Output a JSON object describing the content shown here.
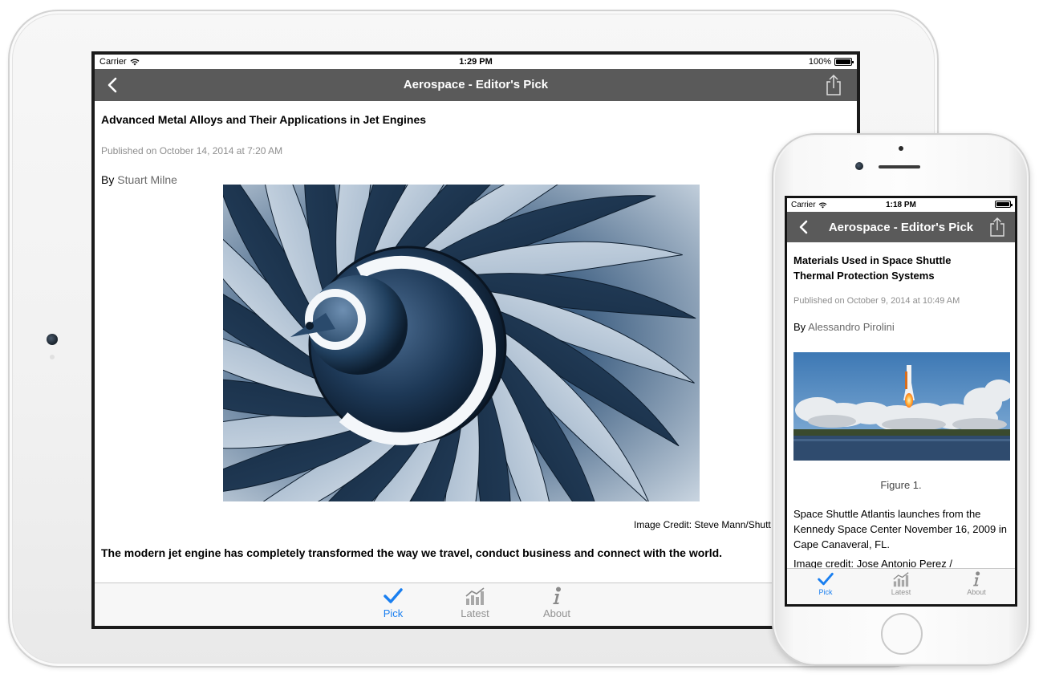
{
  "ipad": {
    "status": {
      "carrier": "Carrier",
      "time": "1:29 PM",
      "battery": "100%"
    },
    "nav": {
      "title": "Aerospace - Editor's Pick"
    },
    "article": {
      "title": "Advanced Metal Alloys and Their Applications in Jet Engines",
      "published": "Published on October 14, 2014 at 7:20 AM",
      "by": "By",
      "author": "Stuart Milne",
      "image_credit": "Image Credit: Steve Mann/Shutt",
      "lead": "The modern jet engine has completely transformed the way we travel, conduct business and connect with the world."
    },
    "tabs": [
      {
        "label": "Pick",
        "icon": "checkmark-icon",
        "active": true
      },
      {
        "label": "Latest",
        "icon": "chart-icon",
        "active": false
      },
      {
        "label": "About",
        "icon": "info-icon",
        "active": false
      }
    ]
  },
  "iphone": {
    "status": {
      "carrier": "Carrier",
      "time": "1:18 PM"
    },
    "nav": {
      "title": "Aerospace - Editor's Pick"
    },
    "article": {
      "title": "Materials Used in Space Shuttle Thermal Protection Systems",
      "published": "Published on October 9, 2014 at 10:49 AM",
      "by": "By",
      "author": "Alessandro Pirolini",
      "figure": "Figure 1.",
      "caption": "Space Shuttle Atlantis launches from the Kennedy Space Center November 16, 2009 in Cape Canaveral, FL.",
      "credit": "Image credit: Jose Antonio Perez /"
    },
    "tabs": [
      {
        "label": "Pick",
        "icon": "checkmark-icon",
        "active": true
      },
      {
        "label": "Latest",
        "icon": "chart-icon",
        "active": false
      },
      {
        "label": "About",
        "icon": "info-icon",
        "active": false
      }
    ]
  },
  "colors": {
    "navbar": "#5a5a5a",
    "active_tab": "#1a7ff0",
    "inactive_tab": "#929292",
    "meta_text": "#8e8e8e"
  }
}
